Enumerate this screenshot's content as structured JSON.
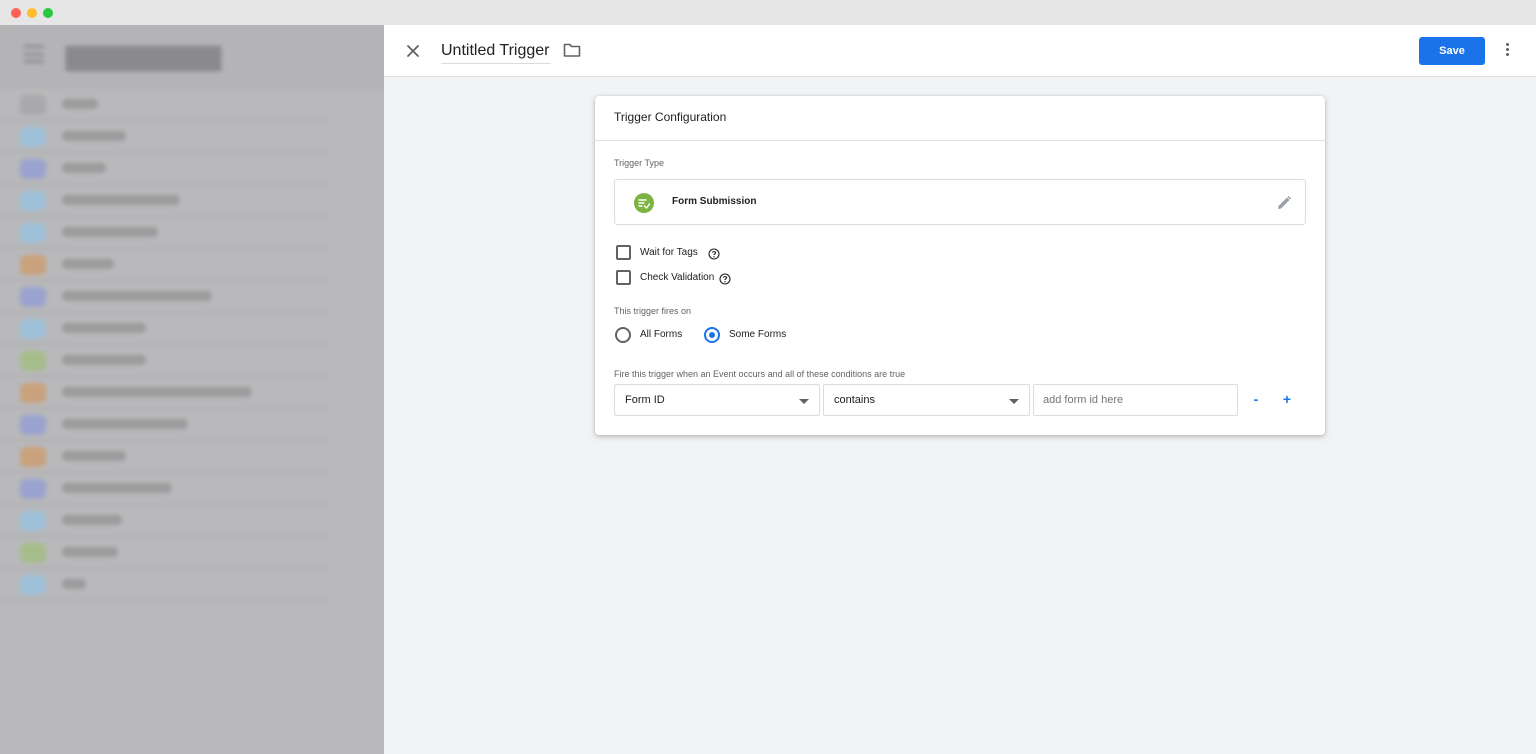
{
  "window": {
    "controls": [
      "close",
      "minimize",
      "maximize"
    ]
  },
  "background_list": {
    "rows": [
      {
        "color": "#9ec0d8"
      },
      {
        "color": "#9aa3cf"
      },
      {
        "color": "#9ec0d8"
      },
      {
        "color": "#9ec0d8"
      },
      {
        "color": "#c9a27d"
      },
      {
        "color": "#9aa3cf"
      },
      {
        "color": "#9ec0d8"
      },
      {
        "color": "#a6bd8b"
      },
      {
        "color": "#c9a27d"
      },
      {
        "color": "#9aa3cf"
      },
      {
        "color": "#c9a27d"
      },
      {
        "color": "#9aa3cf"
      },
      {
        "color": "#9ec0d8"
      },
      {
        "color": "#a6bd8b"
      },
      {
        "color": "#9ec0d8"
      }
    ]
  },
  "topbar": {
    "title": "Untitled Trigger",
    "save_label": "Save",
    "accent": "#1a73e8"
  },
  "card": {
    "heading": "Trigger Configuration",
    "trigger_type_label": "Trigger Type",
    "trigger_type_name": "Form Submission",
    "trigger_type_icon": "form-submission-icon",
    "trigger_type_color": "#7cb342",
    "checkboxes": [
      {
        "label": "Wait for Tags",
        "checked": false
      },
      {
        "label": "Check Validation",
        "checked": false
      }
    ],
    "fires_on_label": "This trigger fires on",
    "radios": [
      {
        "label": "All Forms",
        "selected": false
      },
      {
        "label": "Some Forms",
        "selected": true
      }
    ],
    "conditions_label": "Fire this trigger when an Event occurs and all of these conditions are true",
    "condition": {
      "variable": "Form ID",
      "operator": "contains",
      "value": "",
      "value_placeholder": "add form id here"
    },
    "remove_label": "-",
    "add_label": "+"
  }
}
